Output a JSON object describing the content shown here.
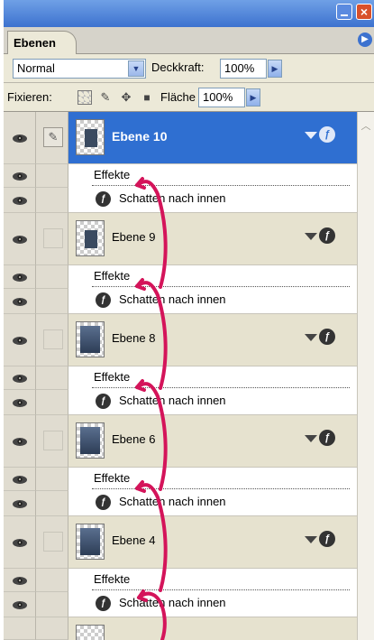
{
  "panel": {
    "tab_label": "Ebenen",
    "blend_mode": "Normal",
    "opacity_label": "Deckkraft:",
    "opacity_value": "100%",
    "lock_label": "Fixieren:",
    "fill_label": "Fläche",
    "fill_value": "100%"
  },
  "icons": {
    "minimize": "minimize-icon",
    "close": "close-icon",
    "panel_menu": "panel-menu-icon",
    "lock_transparency": "lock-transparency-icon",
    "lock_paint": "brush-icon",
    "lock_position": "move-icon",
    "lock_all": "lock-icon",
    "visibility": "eye-icon",
    "effects": "fx-icon"
  },
  "colors": {
    "selection": "#2f6fd1",
    "annotation_arrow": "#d4145a",
    "panel_bg": "#ece9d8"
  },
  "layers": [
    {
      "name": "Ebene 10",
      "selected": true,
      "effects_label": "Effekte",
      "effect": "Schatten nach innen"
    },
    {
      "name": "Ebene 9",
      "selected": false,
      "effects_label": "Effekte",
      "effect": "Schatten nach innen"
    },
    {
      "name": "Ebene 8",
      "selected": false,
      "effects_label": "Effekte",
      "effect": "Schatten nach innen"
    },
    {
      "name": "Ebene 6",
      "selected": false,
      "effects_label": "Effekte",
      "effect": "Schatten nach innen"
    },
    {
      "name": "Ebene 4",
      "selected": false,
      "effects_label": "Effekte",
      "effect": "Schatten nach innen"
    }
  ]
}
